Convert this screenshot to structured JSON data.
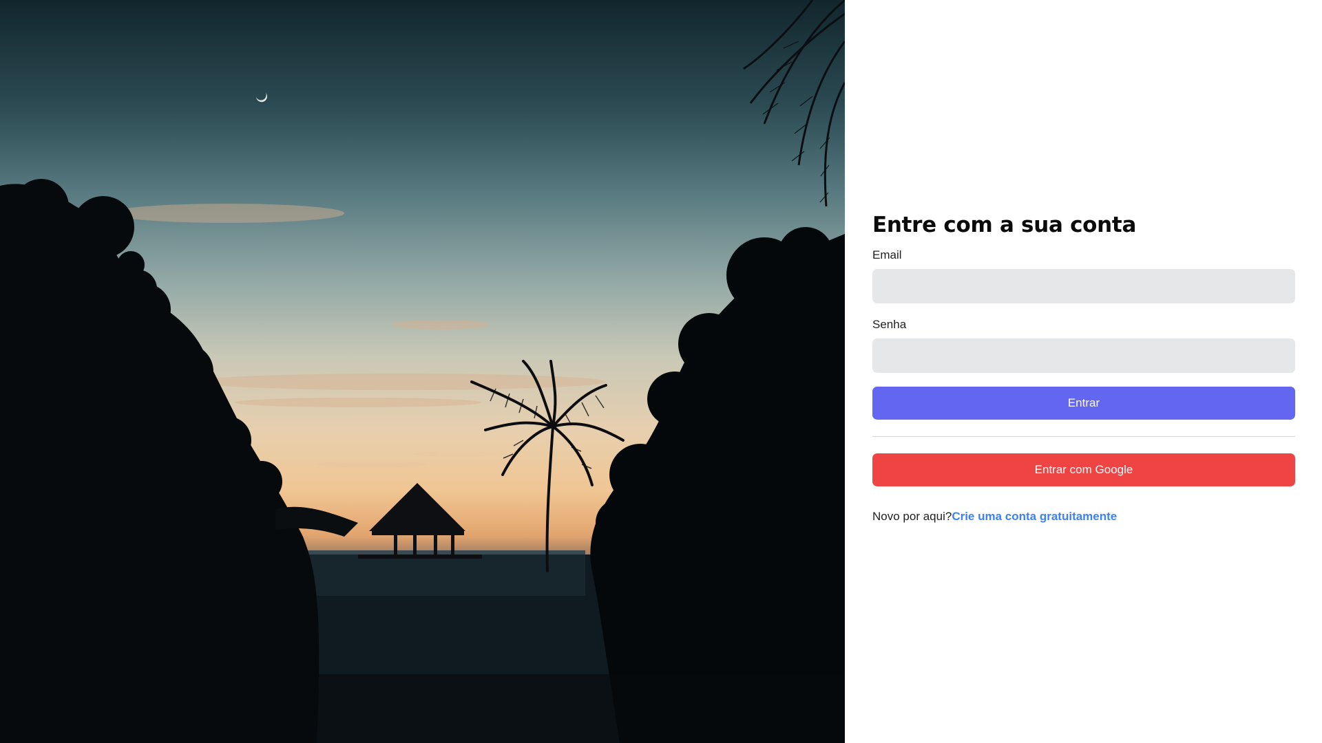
{
  "login": {
    "title": "Entre com a sua conta",
    "email_label": "Email",
    "email_value": "",
    "password_label": "Senha",
    "password_value": "",
    "submit_label": "Entrar",
    "google_label": "Entrar com Google",
    "signup_prompt": "Novo por aqui?",
    "signup_link": "Crie uma conta gratuitamente"
  },
  "colors": {
    "primary_button": "#6366f1",
    "google_button": "#ef4444",
    "link": "#3b82f6",
    "input_background": "#e6e7e9"
  }
}
